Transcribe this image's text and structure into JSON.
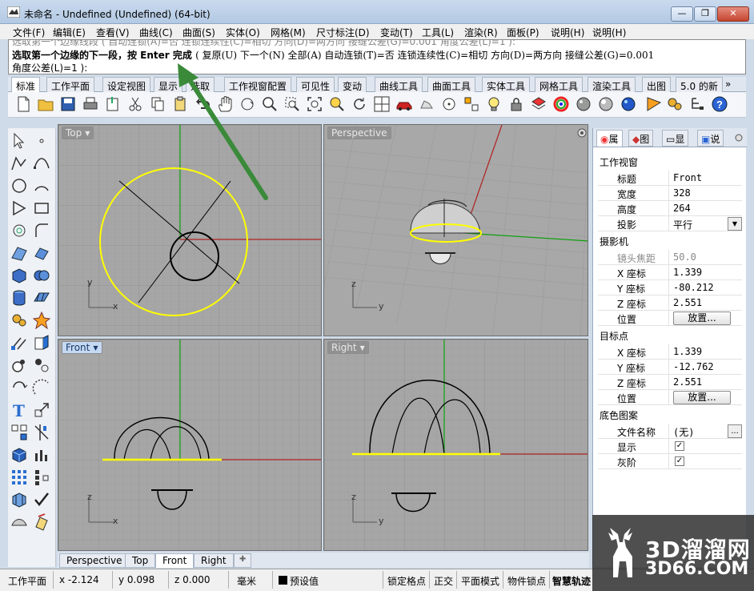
{
  "window": {
    "title": "未命名 - Undefined (Undefined) (64-bit)",
    "min": "—",
    "max": "❐",
    "close": "✕"
  },
  "menu": [
    "文件(F)",
    "编辑(E)",
    "查看(V)",
    "曲线(C)",
    "曲面(S)",
    "实体(O)",
    "网格(M)",
    "尺寸标注(D)",
    "变动(T)",
    "工具(L)",
    "渲染(R)",
    "面板(P)",
    "说明(H)"
  ],
  "command": {
    "history": "选取第一个边缘线段 ( 自动连锁(A)=否  连锁连续性(C)=相切  方向(D)=两方向  接缝公差(G)=0.001  角度公差(L)=1 ):",
    "prompt_main": "选取第一个边缘的下一段，按 Enter 完成",
    "prompt_options": "( 复原(U)  下一个(N)  全部(A)  自动连锁(T)=否  连锁连续性(C)=相切  方向(D)=两方向  接缝公差(G)=0.001",
    "input_line": "角度公差(L)=1 ):"
  },
  "tabs": [
    "标准",
    "工作平面",
    "设定视图",
    "显示",
    "选取",
    "工作视窗配置",
    "可见性",
    "变动",
    "曲线工具",
    "曲面工具",
    "实体工具",
    "网格工具",
    "渲染工具",
    "出图",
    "5.0 的新"
  ],
  "tabs_more": "»",
  "viewports": {
    "top": {
      "label": "Top",
      "axis_x": "x",
      "axis_y": "y"
    },
    "perspective": {
      "label": "Perspective",
      "axis_x": "y",
      "axis_y": "z"
    },
    "front": {
      "label": "Front",
      "axis_x": "x",
      "axis_y": "z"
    },
    "right": {
      "label": "Right",
      "axis_x": "y",
      "axis_y": "z"
    }
  },
  "view_tabs": [
    "Perspective",
    "Top",
    "Front",
    "Right"
  ],
  "view_tab_add": "✚",
  "panel": {
    "tabs": [
      "属",
      "图",
      "显",
      "说"
    ],
    "section_viewport": "工作视窗",
    "title_k": "标题",
    "title_v": "Front",
    "width_k": "宽度",
    "width_v": "328",
    "height_k": "高度",
    "height_v": "264",
    "proj_k": "投影",
    "proj_v": "平行",
    "section_camera": "摄影机",
    "focal_k": "镜头焦距",
    "focal_v": "50.0",
    "cx_k": "X 座标",
    "cx_v": "1.339",
    "cy_k": "Y 座标",
    "cy_v": "-80.212",
    "cz_k": "Z 座标",
    "cz_v": "2.551",
    "pos_k": "位置",
    "place_btn": "放置...",
    "section_target": "目标点",
    "tx_k": "X 座标",
    "tx_v": "1.339",
    "ty_k": "Y 座标",
    "ty_v": "-12.762",
    "tz_k": "Z 座标",
    "tz_v": "2.551",
    "tpos_k": "位置",
    "tplace_btn": "放置...",
    "section_wallpaper": "底色图案",
    "file_k": "文件名称",
    "file_v": "(无)",
    "file_btn": "...",
    "show_k": "显示",
    "show_v": "✓",
    "gray_k": "灰阶",
    "gray_v": "✓"
  },
  "status": {
    "plane": "工作平面",
    "x": "x -2.124",
    "y": "y 0.098",
    "z": "z 0.000",
    "unit": "毫米",
    "layer": "预设值",
    "osnap": "锁定格点",
    "ortho": "正交",
    "planar": "平面模式",
    "snap": "物件锁点",
    "smart": "智慧轨迹"
  },
  "watermark": {
    "line1": "3D溜溜网",
    "line2": "3D66.COM"
  },
  "colors": {
    "accent_yellow": "#ffff00",
    "axis_red": "#b02020",
    "axis_green": "#10a010",
    "arrow_green": "#3a8a3a"
  }
}
